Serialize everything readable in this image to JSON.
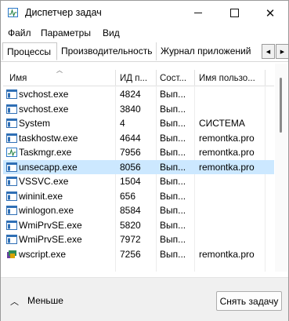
{
  "window": {
    "title": "Диспетчер задач",
    "minimize_icon": "minimize-icon",
    "maximize_icon": "maximize-icon",
    "close_glyph": "✕"
  },
  "menu": [
    "Файл",
    "Параметры",
    "Вид"
  ],
  "tabs": [
    "Процессы",
    "Производительность",
    "Журнал приложений"
  ],
  "tab_arrows": {
    "left": "◀",
    "right": "▶"
  },
  "table": {
    "sort_glyph": "︿",
    "columns": {
      "name": "Имя",
      "pid": "ИД п...",
      "state": "Сост...",
      "user": "Имя пользо..."
    },
    "rows": [
      {
        "name": "svchost.exe",
        "pid": "4824",
        "state": "Вып...",
        "user": "",
        "icon": "service-icon"
      },
      {
        "name": "svchost.exe",
        "pid": "3840",
        "state": "Вып...",
        "user": "",
        "icon": "service-icon"
      },
      {
        "name": "System",
        "pid": "4",
        "state": "Вып...",
        "user": "СИСТЕМА",
        "icon": "service-icon"
      },
      {
        "name": "taskhostw.exe",
        "pid": "4644",
        "state": "Вып...",
        "user": "remontka.pro",
        "icon": "service-icon"
      },
      {
        "name": "Taskmgr.exe",
        "pid": "7956",
        "state": "Вып...",
        "user": "remontka.pro",
        "icon": "task-manager-icon"
      },
      {
        "name": "unsecapp.exe",
        "pid": "8056",
        "state": "Вып...",
        "user": "remontka.pro",
        "icon": "service-icon",
        "selected": true
      },
      {
        "name": "VSSVC.exe",
        "pid": "1504",
        "state": "Вып...",
        "user": "",
        "icon": "service-icon"
      },
      {
        "name": "wininit.exe",
        "pid": "656",
        "state": "Вып...",
        "user": "",
        "icon": "service-icon"
      },
      {
        "name": "winlogon.exe",
        "pid": "8584",
        "state": "Вып...",
        "user": "",
        "icon": "service-icon"
      },
      {
        "name": "WmiPrvSE.exe",
        "pid": "5820",
        "state": "Вып...",
        "user": "",
        "icon": "service-icon"
      },
      {
        "name": "WmiPrvSE.exe",
        "pid": "7972",
        "state": "Вып...",
        "user": "",
        "icon": "service-icon"
      },
      {
        "name": "wscript.exe",
        "pid": "7256",
        "state": "Вып...",
        "user": "remontka.pro",
        "icon": "script-icon"
      }
    ]
  },
  "footer": {
    "less_glyph": "︿",
    "less_label": "Меньше",
    "end_task_label": "Снять задачу"
  },
  "colors": {
    "selection": "#cce8ff",
    "footer_bg": "#f0f0f0",
    "icon_blue": "#2f6fb5"
  }
}
